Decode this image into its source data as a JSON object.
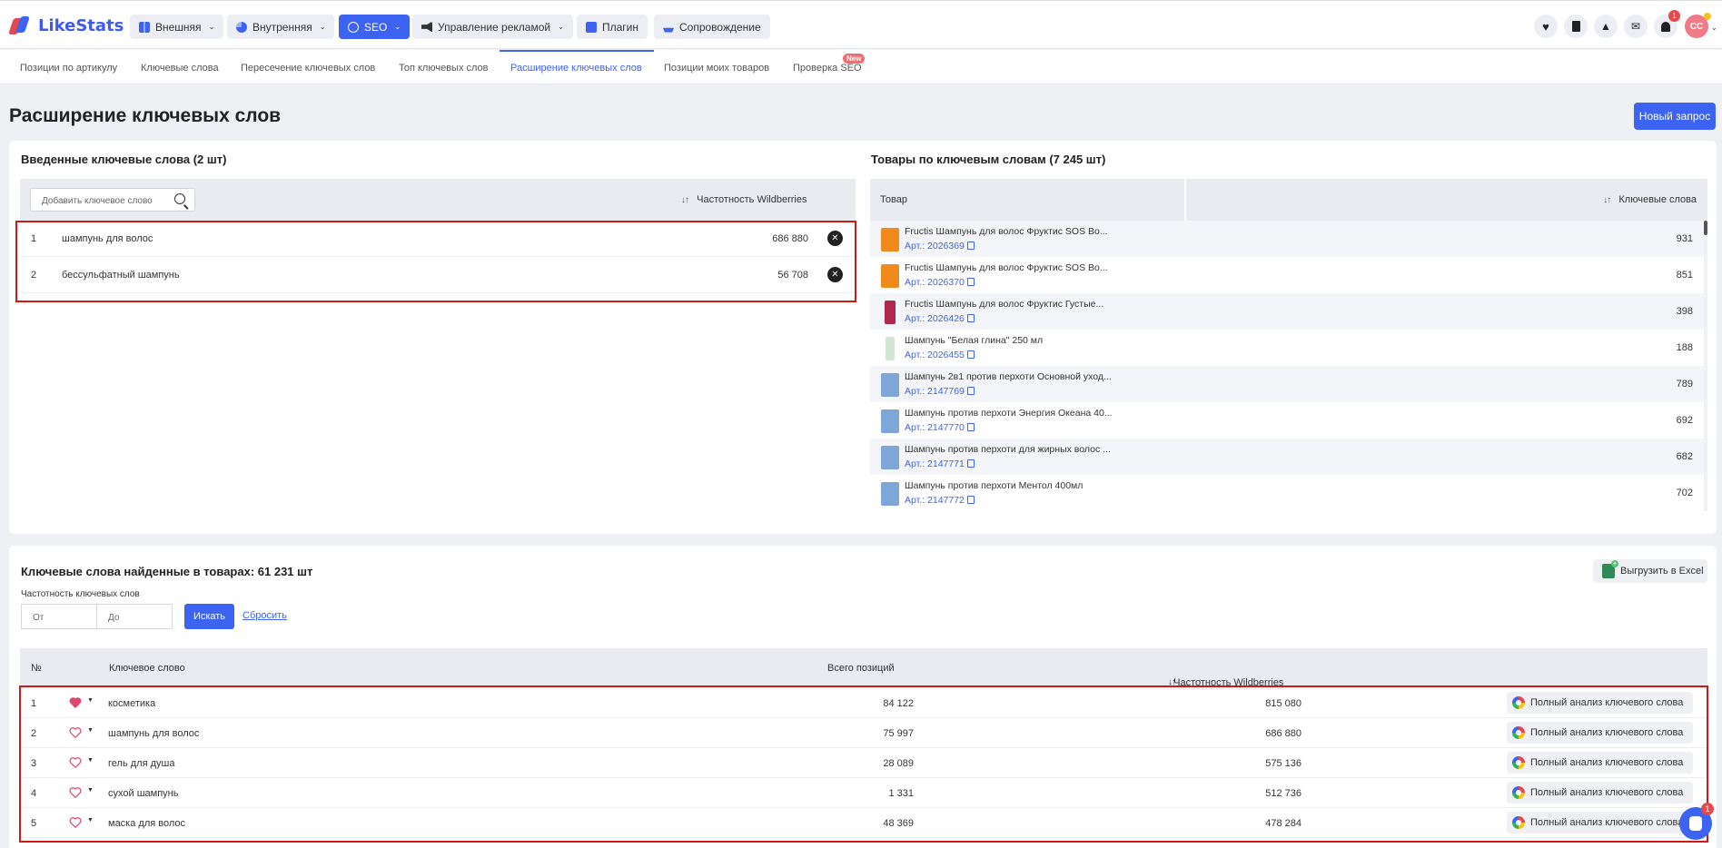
{
  "app": {
    "name": "LikeStats"
  },
  "topnav": {
    "items": [
      {
        "label": "Внешняя",
        "icon": "grid-icon",
        "active": false
      },
      {
        "label": "Внутренняя",
        "icon": "pie-chart-icon",
        "active": false
      },
      {
        "label": "SEO",
        "icon": "seo-icon",
        "active": true
      },
      {
        "label": "Управление рекламой",
        "icon": "megaphone-icon",
        "active": false
      },
      {
        "label": "Плагин",
        "icon": "plugin-icon",
        "active": false
      },
      {
        "label": "Сопровождение",
        "icon": "ship-icon",
        "active": false
      }
    ],
    "notification_count": "1",
    "avatar_initials": "CC"
  },
  "subtabs": {
    "items": [
      "Позиции по артикулу",
      "Ключевые слова",
      "Пересечение ключевых слов",
      "Топ ключевых слов",
      "Расширение ключевых слов",
      "Позиции моих товаров",
      "Проверка SEO"
    ],
    "active_index": 4,
    "new_badge": "New"
  },
  "page": {
    "title": "Расширение ключевых слов",
    "new_request_label": "Новый запрос"
  },
  "entered": {
    "title": "Введенные ключевые слова (2 шт)",
    "add_placeholder": "Добавить ключевое слово",
    "freq_header": "Частотность Wildberries",
    "rows": [
      {
        "n": "1",
        "keyword": "шампунь для волос",
        "freq": "686 880"
      },
      {
        "n": "2",
        "keyword": "бессульфатный шампунь",
        "freq": "56 708"
      }
    ]
  },
  "products": {
    "title": "Товары по ключевым словам (7 245 шт)",
    "col_product": "Товар",
    "col_keywords": "Ключевые слова",
    "rows": [
      {
        "name": "Fructis Шампунь для волос Фруктис SOS Во...",
        "art": "Арт.: 2026369",
        "count": "931",
        "img": "#f08a1c"
      },
      {
        "name": "Fructis Шампунь для волос Фруктис SOS Во...",
        "art": "Арт.: 2026370",
        "count": "851",
        "img": "#f08a1c"
      },
      {
        "name": "Fructis Шампунь для волос Фруктис Густые...",
        "art": "Арт.: 2026426",
        "count": "398",
        "img": "#b0284d"
      },
      {
        "name": "Шампунь \"Белая глина\" 250 мл",
        "art": "Арт.: 2026455",
        "count": "188",
        "img": "#cfe6d3"
      },
      {
        "name": "Шампунь 2в1 против перхоти Основной уход...",
        "art": "Арт.: 2147769",
        "count": "789",
        "img": "#7ea6d8"
      },
      {
        "name": "Шампунь против перхоти Энергия Океана 40...",
        "art": "Арт.: 2147770",
        "count": "692",
        "img": "#7ea6d8"
      },
      {
        "name": "Шампунь против перхоти для жирных волос ...",
        "art": "Арт.: 2147771",
        "count": "682",
        "img": "#7ea6d8"
      },
      {
        "name": "Шампунь против перхоти Ментол 400мл",
        "art": "Арт.: 2147772",
        "count": "702",
        "img": "#7ea6d8"
      }
    ]
  },
  "found": {
    "title": "Ключевые слова найденные в товарах: 61 231 шт",
    "excel_label": "Выгрузить в Excel",
    "freq_label": "Частотность ключевых слов",
    "from_placeholder": "От",
    "to_placeholder": "До",
    "search_label": "Искать",
    "reset_label": "Сбросить",
    "headers": {
      "n": "№",
      "keyword": "Ключевое слово",
      "positions": "Всего позиций",
      "freq": "Частотность Wildberries"
    },
    "analysis_label": "Полный анализ ключевого слова",
    "rows": [
      {
        "n": "1",
        "keyword": "косметика",
        "positions": "84 122",
        "freq": "815 080",
        "favorite": true
      },
      {
        "n": "2",
        "keyword": "шампунь для волос",
        "positions": "75 997",
        "freq": "686 880",
        "favorite": false
      },
      {
        "n": "3",
        "keyword": "гель для душа",
        "positions": "28 089",
        "freq": "575 136",
        "favorite": false
      },
      {
        "n": "4",
        "keyword": "сухой шампунь",
        "positions": "1 331",
        "freq": "512 736",
        "favorite": false
      },
      {
        "n": "5",
        "keyword": "маска для волос",
        "positions": "48 369",
        "freq": "478 284",
        "favorite": false
      }
    ]
  },
  "chat": {
    "badge": "1"
  },
  "colors": {
    "accent": "#3d63f2",
    "highlight_border": "#d31616",
    "favorite": "#e0456b"
  }
}
